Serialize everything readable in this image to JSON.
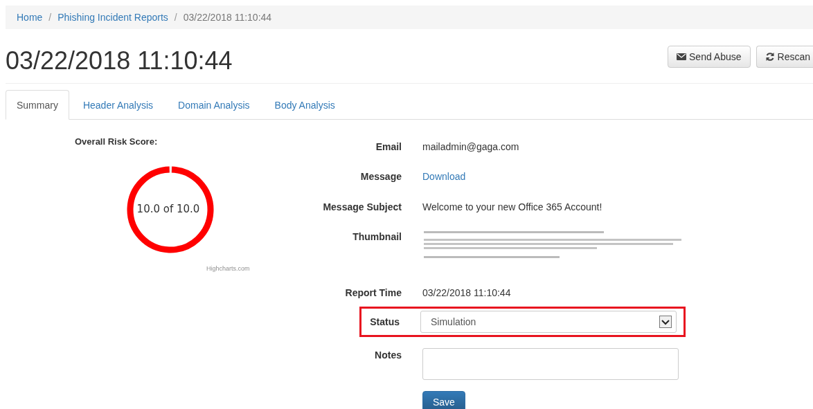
{
  "breadcrumb": [
    {
      "label": "Home",
      "kind": "link"
    },
    {
      "label": "/",
      "kind": "separator"
    },
    {
      "label": "Phishing Incident Reports",
      "kind": "link"
    },
    {
      "label": "/",
      "kind": "separator"
    },
    {
      "label": "03/22/2018 11:10:44",
      "kind": "current"
    }
  ],
  "title": "03/22/2018 11:10:44",
  "actions": [
    {
      "label": "Send Abuse",
      "kind": "envelope"
    },
    {
      "label": "Rescan",
      "kind": "refresh"
    }
  ],
  "tabs": [
    {
      "label": "Summary",
      "selected": true
    },
    {
      "label": "Header Analysis",
      "selected": false
    },
    {
      "label": "Domain Analysis",
      "selected": false
    },
    {
      "label": "Body Analysis",
      "selected": false
    }
  ],
  "risk": {
    "title": "Overall Risk Score:",
    "score": "10.0 of 10.0",
    "level": 1,
    "credit": "Highcharts.com"
  },
  "fields": [
    {
      "label": "Email",
      "kind": "text",
      "value": "mailadmin@gaga.com"
    },
    {
      "label": "Message",
      "kind": "link",
      "value": "Download"
    },
    {
      "label": "Message Subject",
      "kind": "text",
      "value": "Welcome to your new Office 365 Account!"
    },
    {
      "label": "Thumbnail",
      "kind": "picture"
    },
    {
      "label": "Report Time",
      "kind": "text",
      "value": "03/22/2018 11:10:44"
    },
    {
      "label": "Status",
      "kind": "select",
      "value": "Simulation",
      "highlighted": true
    },
    {
      "label": "Notes",
      "kind": "textarea"
    }
  ],
  "save": "Save"
}
